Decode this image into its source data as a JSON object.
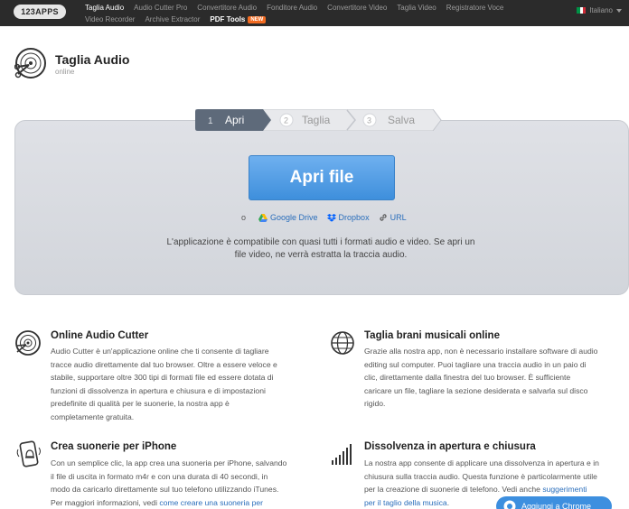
{
  "topbar": {
    "logo": "123APPS",
    "nav_row1": [
      "Taglia Audio",
      "Audio Cutter Pro",
      "Convertitore Audio",
      "Fonditore Audio",
      "Convertitore Video",
      "Taglia Video",
      "Registratore Voce"
    ],
    "nav_row2": [
      "Video Recorder",
      "Archive Extractor"
    ],
    "pdf_tools": "PDF Tools",
    "new_badge": "NEW",
    "language": "Italiano",
    "colors": {
      "background": "#2b2b2b",
      "active": "#ffffff",
      "badge": "#f26b21"
    }
  },
  "app": {
    "title": "Taglia Audio",
    "subtitle": "online",
    "icon": "vinyl-scissors-icon"
  },
  "steps": [
    {
      "number": "1",
      "label": "Apri",
      "active": true
    },
    {
      "number": "2",
      "label": "Taglia",
      "active": false
    },
    {
      "number": "3",
      "label": "Salva",
      "active": false
    }
  ],
  "panel": {
    "open_button": "Apri file",
    "or": "o",
    "sources": [
      {
        "label": "Google Drive",
        "icon": "google-drive-icon"
      },
      {
        "label": "Dropbox",
        "icon": "dropbox-icon"
      },
      {
        "label": "URL",
        "icon": "link-icon"
      }
    ],
    "compat_line1": "L'applicazione è compatibile con quasi tutti i formati audio e video. Se apri un",
    "compat_line2": "file video, ne verrà estratta la traccia audio.",
    "accent": "#3e8fdc"
  },
  "features": [
    {
      "title": "Online Audio Cutter",
      "icon": "vinyl-icon",
      "lines": [
        "Audio Cutter è un'applicazione online che ti consente di tagliare",
        "tracce audio direttamente dal tuo browser. Oltre a essere veloce e",
        "stabile, supportare oltre 300 tipi di formati file ed essere dotata di",
        "funzioni di dissolvenza in apertura e chiusura e di impostazioni",
        "predefinite di qualità per le suonerie, la nostra app è",
        "completamente gratuita."
      ]
    },
    {
      "title": "Taglia brani musicali online",
      "icon": "globe-icon",
      "lines": [
        "Grazie alla nostra app, non è necessario installare software di audio",
        "editing sul computer. Puoi tagliare una traccia audio in un paio di",
        "clic, direttamente dalla finestra del tuo browser. È sufficiente",
        "caricare un file, tagliare la sezione desiderata e salvarla sul disco",
        "rigido."
      ]
    },
    {
      "title": "Crea suonerie per iPhone",
      "icon": "phone-bell-icon",
      "lines": [
        "Con un semplice clic, la app crea una suoneria per iPhone, salvando",
        "il file di uscita in formato m4r e con una durata di 40 secondi, in",
        "modo da caricarlo direttamente sul tuo telefono utilizzando iTunes."
      ],
      "last_prefix": "Per maggiori informazioni, vedi ",
      "last_link": "come creare una suoneria per"
    },
    {
      "title": "Dissolvenza in apertura e chiusura",
      "icon": "fade-bars-icon",
      "lines": [
        "La nostra app consente di applicare una dissolvenza in apertura e in",
        "chiusura sulla traccia audio. Questa funzione è particolarmente utile"
      ],
      "line3_prefix": "per la creazione di suonerie di telefono. Vedi anche ",
      "line3_link": "suggerimenti",
      "line4_link": "per il taglio della musica",
      "line4_suffix": "."
    }
  ],
  "chrome_button": "Aggiungi a Chrome"
}
